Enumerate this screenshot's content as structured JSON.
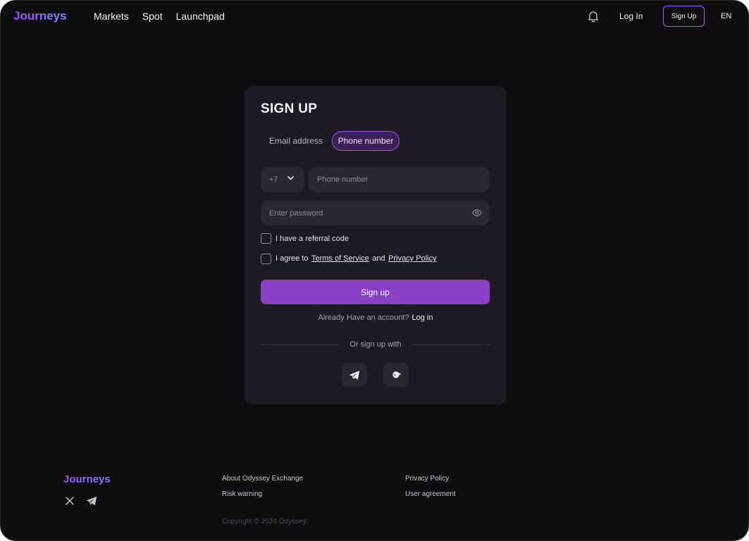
{
  "header": {
    "logo": "Journeys",
    "nav": [
      "Markets",
      "Spot",
      "Launchpad"
    ],
    "bell_icon": "bell-icon",
    "login_label": "Log In",
    "signup_label": "Sign Up",
    "language": "EN"
  },
  "form": {
    "title": "SIGN UP",
    "tabs": {
      "email": "Email address",
      "phone": "Phone number",
      "active": "phone"
    },
    "country_code": "+7",
    "phone_placeholder": "Phone number",
    "password_placeholder": "Enter password",
    "referral_label": "I have a referral code",
    "agree_prefix": "I agree to",
    "terms_link": "Terms of Service",
    "agree_and": "and",
    "privacy_link": "Privacy Policy",
    "submit_label": "Sign up",
    "already_text": "Already Have an account?",
    "login_link": "Log in",
    "or_text": "Or sign up with",
    "social": [
      "telegram-icon",
      "google-icon"
    ]
  },
  "footer": {
    "logo": "Journeys",
    "social": [
      "x-icon",
      "telegram-icon"
    ],
    "links_col1": [
      "About Odyssey Exchange",
      "Risk warning"
    ],
    "links_col2": [
      "Privacy Policy",
      "User agreement"
    ],
    "copyright": "Copyright © 2024 Odyssey."
  },
  "colors": {
    "background": "#0f0d10",
    "card": "#1e1a24",
    "input": "#2b2731",
    "accent": "#8a3fc7",
    "accent_border": "#a65cff"
  }
}
